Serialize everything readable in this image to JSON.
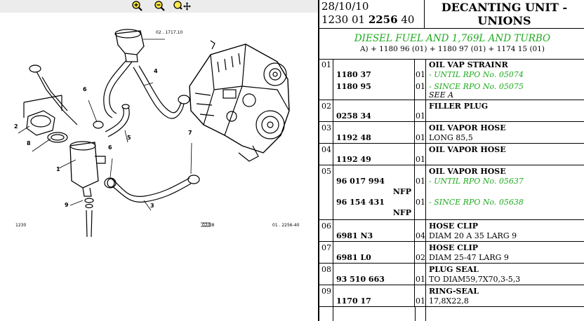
{
  "toolbar": {
    "zoom_in_icon": "magnifier-plus-icon",
    "zoom_out_icon": "magnifier-minus-icon",
    "pan_icon": "magnifier-move-icon"
  },
  "diagram": {
    "drawing_ref_top": "02 . 1717.10",
    "page_code": "1230",
    "sheet": "02/88",
    "drawing_ref_bottom": "01 . 2256-40",
    "callouts": [
      "1",
      "2",
      "3",
      "4",
      "5",
      "6",
      "6",
      "7",
      "8",
      "9"
    ]
  },
  "header": {
    "date": "28/10/10",
    "ref_prefix": "1230 01",
    "ref_bold": "2256",
    "ref_suffix": "40",
    "title_line1": "DECANTING UNIT -",
    "title_line2": "UNIONS"
  },
  "engine": {
    "description": "DIESEL FUEL AND 1,769L AND TURBO",
    "codes": "A) + 1180 96 (01) + 1180 97 (01) + 1174 15 (01)"
  },
  "colors": {
    "green": "#1faa1f"
  },
  "rows": [
    {
      "index": "01",
      "name": "OIL VAP STRAINR",
      "lines": [
        {
          "ref": "1180 37",
          "qty": "01",
          "text": "- UNTIL RPO No. 05074",
          "style": "green"
        },
        {
          "ref": "1180 95",
          "qty": "01",
          "text": "- SINCE RPO No. 05075",
          "style": "green"
        },
        {
          "ref": "",
          "qty": "",
          "text": "SEE A",
          "style": "italic"
        }
      ]
    },
    {
      "index": "02",
      "name": "FILLER PLUG",
      "lines": [
        {
          "ref": "0258 34",
          "qty": "01",
          "text": "",
          "style": ""
        }
      ]
    },
    {
      "index": "03",
      "name": "OIL VAPOR HOSE",
      "lines": [
        {
          "ref": "1192 48",
          "qty": "01",
          "text": "LONG 85,5",
          "style": ""
        }
      ]
    },
    {
      "index": "04",
      "name": "OIL VAPOR HOSE",
      "lines": [
        {
          "ref": "1192 49",
          "qty": "01",
          "text": "",
          "style": ""
        }
      ]
    },
    {
      "index": "05",
      "name": "OIL VAPOR HOSE",
      "lines": [
        {
          "ref": "96 017 994",
          "qty": "01",
          "text": "- UNTIL RPO No. 05637",
          "style": "green"
        },
        {
          "nfp": "NFP"
        },
        {
          "ref": "96 154 431",
          "qty": "01",
          "text": "- SINCE RPO No. 05638",
          "style": "green"
        },
        {
          "nfp": "NFP"
        }
      ]
    },
    {
      "index": "06",
      "name": "HOSE CLIP",
      "lines": [
        {
          "ref": "6981 N3",
          "qty": "04",
          "text": "DIAM 20 A 35 LARG 9",
          "style": ""
        }
      ]
    },
    {
      "index": "07",
      "name": "HOSE CLIP",
      "lines": [
        {
          "ref": "6981 L0",
          "qty": "02",
          "text": "DIAM 25-47 LARG 9",
          "style": ""
        }
      ]
    },
    {
      "index": "08",
      "name": "PLUG SEAL",
      "lines": [
        {
          "ref": "93 510 663",
          "qty": "01",
          "text": "TO DIAM59,7X70,3-5,3",
          "style": ""
        }
      ]
    },
    {
      "index": "09",
      "name": "RING-SEAL",
      "lines": [
        {
          "ref": "1170 17",
          "qty": "01",
          "text": "17,8X22,8",
          "style": ""
        }
      ]
    }
  ]
}
